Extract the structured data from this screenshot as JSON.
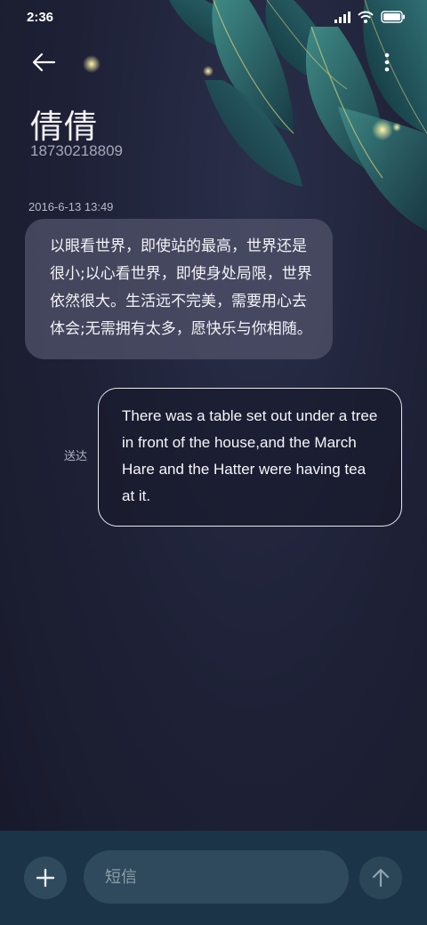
{
  "status_bar": {
    "time": "2:36",
    "icons": [
      "signal-icon",
      "wifi-icon",
      "battery-icon"
    ]
  },
  "header": {
    "back_icon": "arrow-left-icon",
    "more_icon": "more-vertical-icon",
    "contact_name": "倩倩",
    "contact_number": "18730218809"
  },
  "conversation": {
    "timestamp": "2016-6-13 13:49",
    "messages": [
      {
        "direction": "incoming",
        "text": "以眼看世界，即使站的最高，世界还是很小;以心看世界，即使身处局限，世界依然很大。生活远不完美，需要用心去体会;无需拥有太多，愿快乐与你相随。"
      },
      {
        "direction": "outgoing",
        "status": "送达",
        "text": "There was a table set out under a tree in front of the house,and the March Hare and the Hatter were having tea at it."
      }
    ]
  },
  "composer": {
    "add_icon": "plus-icon",
    "placeholder": "短信",
    "value": "",
    "send_icon": "arrow-up-icon"
  },
  "colors": {
    "background": "#1f2238",
    "incoming_bubble": "#4e5168",
    "outgoing_border": "#e9e9ef",
    "composer_bar": "#1c3447",
    "composer_field": "#2e4a5c"
  }
}
